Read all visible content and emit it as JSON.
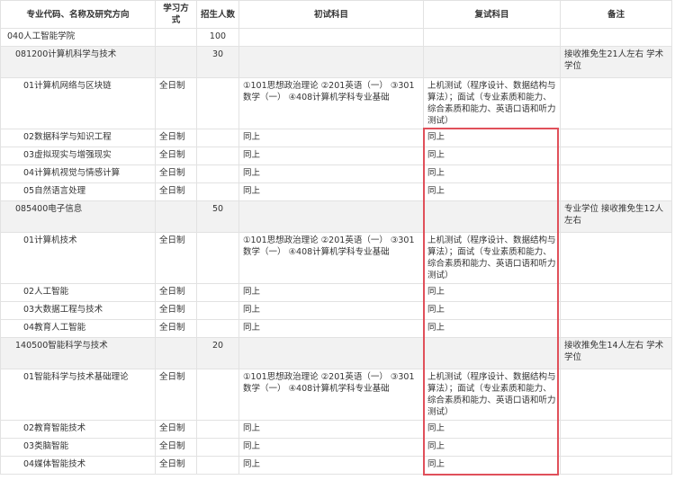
{
  "headers": [
    "专业代码、名称及研究方向",
    "学习方式",
    "招生人数",
    "初试科目",
    "复试科目",
    "备注"
  ],
  "rows": [
    {
      "level": 0,
      "shade": false,
      "cells": [
        "040人工智能学院",
        "",
        "100",
        "",
        "",
        ""
      ]
    },
    {
      "level": 1,
      "shade": true,
      "cells": [
        "081200计算机科学与技术",
        "",
        "30",
        "",
        "",
        "接收推免生21人左右 学术学位"
      ]
    },
    {
      "level": 2,
      "shade": false,
      "cells": [
        "01计算机网络与区块链",
        "全日制",
        "",
        "①101思想政治理论 ②201英语（一） ③301数学（一） ④408计算机学科专业基础",
        "上机测试（程序设计、数据结构与算法）；面试（专业素质和能力、综合素质和能力、英语口语和听力测试）",
        ""
      ]
    },
    {
      "level": 2,
      "shade": false,
      "cells": [
        "02数据科学与知识工程",
        "全日制",
        "",
        "同上",
        "同上",
        ""
      ]
    },
    {
      "level": 2,
      "shade": false,
      "cells": [
        "03虚拟现实与增强现实",
        "全日制",
        "",
        "同上",
        "同上",
        ""
      ]
    },
    {
      "level": 2,
      "shade": false,
      "cells": [
        "04计算机视觉与情感计算",
        "全日制",
        "",
        "同上",
        "同上",
        ""
      ]
    },
    {
      "level": 2,
      "shade": false,
      "cells": [
        "05自然语言处理",
        "全日制",
        "",
        "同上",
        "同上",
        ""
      ]
    },
    {
      "level": 1,
      "shade": true,
      "cells": [
        "085400电子信息",
        "",
        "50",
        "",
        "",
        "专业学位 接收推免生12人左右"
      ]
    },
    {
      "level": 2,
      "shade": false,
      "cells": [
        "01计算机技术",
        "全日制",
        "",
        "①101思想政治理论 ②201英语（一） ③301数学（一） ④408计算机学科专业基础",
        "上机测试（程序设计、数据结构与算法）；面试（专业素质和能力、综合素质和能力、英语口语和听力测试）",
        ""
      ]
    },
    {
      "level": 2,
      "shade": false,
      "cells": [
        "02人工智能",
        "全日制",
        "",
        "同上",
        "同上",
        ""
      ]
    },
    {
      "level": 2,
      "shade": false,
      "cells": [
        "03大数据工程与技术",
        "全日制",
        "",
        "同上",
        "同上",
        ""
      ]
    },
    {
      "level": 2,
      "shade": false,
      "cells": [
        "04教育人工智能",
        "全日制",
        "",
        "同上",
        "同上",
        ""
      ]
    },
    {
      "level": 1,
      "shade": true,
      "cells": [
        "140500智能科学与技术",
        "",
        "20",
        "",
        "",
        "接收推免生14人左右 学术学位"
      ]
    },
    {
      "level": 2,
      "shade": false,
      "cells": [
        "01智能科学与技术基础理论",
        "全日制",
        "",
        "①101思想政治理论 ②201英语（一） ③301数学（一） ④408计算机学科专业基础",
        "上机测试（程序设计、数据结构与算法）；面试（专业素质和能力、综合素质和能力、英语口语和听力测试）",
        ""
      ]
    },
    {
      "level": 2,
      "shade": false,
      "cells": [
        "02教育智能技术",
        "全日制",
        "",
        "同上",
        "同上",
        ""
      ]
    },
    {
      "level": 2,
      "shade": false,
      "cells": [
        "03类脑智能",
        "全日制",
        "",
        "同上",
        "同上",
        ""
      ]
    },
    {
      "level": 2,
      "shade": false,
      "cells": [
        "04媒体智能技术",
        "全日制",
        "",
        "同上",
        "同上",
        ""
      ]
    }
  ],
  "highlight_color": "#e0505a"
}
